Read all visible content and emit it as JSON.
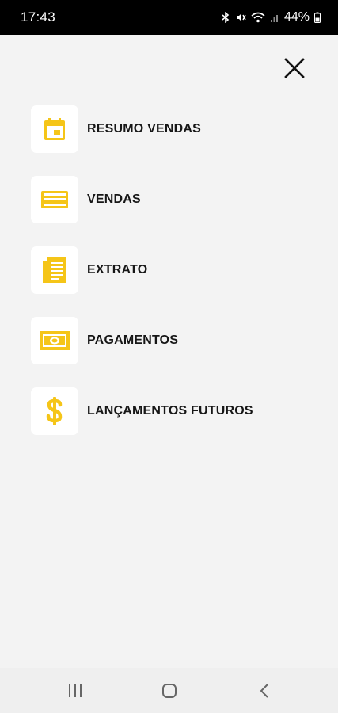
{
  "status_bar": {
    "time": "17:43",
    "battery_percent": "44%",
    "icons": [
      "bluetooth-icon",
      "mute-icon",
      "wifi-icon",
      "signal-icon",
      "battery-icon"
    ]
  },
  "colors": {
    "accent": "#f5c518",
    "background": "#f3f3f3",
    "card": "#ffffff",
    "text": "#161616"
  },
  "menu": {
    "items": [
      {
        "label": "RESUMO VENDAS",
        "icon": "calendar-icon"
      },
      {
        "label": "VENDAS",
        "icon": "credit-card-icon"
      },
      {
        "label": "EXTRATO",
        "icon": "receipt-icon"
      },
      {
        "label": "PAGAMENTOS",
        "icon": "banknote-icon"
      },
      {
        "label": "LANÇAMENTOS FUTUROS",
        "icon": "dollar-icon"
      }
    ]
  },
  "nav": {
    "buttons": [
      "recent-apps-icon",
      "home-icon",
      "back-icon"
    ]
  }
}
